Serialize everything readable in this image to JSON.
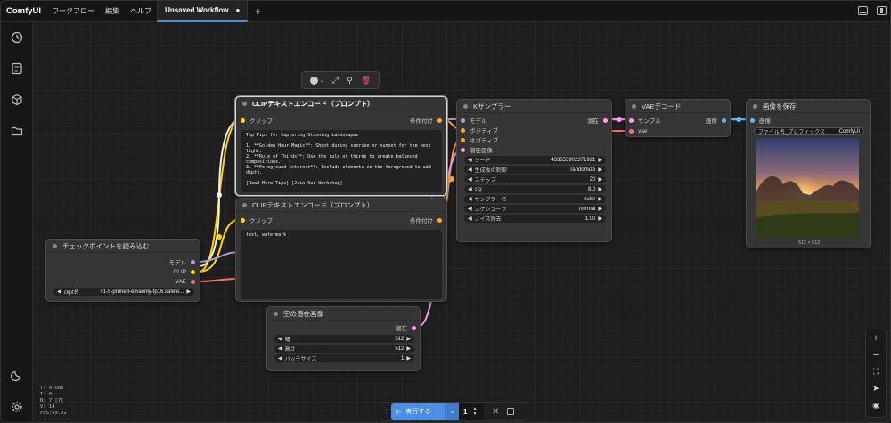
{
  "app": {
    "logo": "ComfyUI",
    "menu": [
      "ワークフロー",
      "編集",
      "ヘルプ"
    ],
    "tab_title": "Unsaved Workflow",
    "tab_modified": "●",
    "new_tab": "+"
  },
  "stats": {
    "t": "T: 0.00s",
    "i": "I: 0",
    "n": "N: 7 [7]",
    "v": "V: 14",
    "fps": "FPS:59.52"
  },
  "nodes": {
    "clip1": {
      "title": "CLIPテキストエンコード（プロンプト）",
      "in": "クリップ",
      "out": "条件付け",
      "text": "Top Tips for Capturing Stunning Landscapes\n\n1. **Golden Hour Magic**: Shoot during sunrise or sunset for the best light.\n2. **Rule of Thirds**: Use the rule of thirds to create balanced compositions.\n3. **Foreground Interest**: Include elements in the foreground to add depth.\n\n[Read More Tips] [Join Our Workshop]"
    },
    "clip2": {
      "title": "CLIPテキストエンコード（プロンプト）",
      "in": "クリップ",
      "out": "条件付け",
      "text": "text, watermark"
    },
    "ckpt": {
      "title": "チェックポイントを読み込む",
      "out_model": "モデル",
      "out_clip": "CLIP",
      "out_vae": "VAE",
      "w_label": "ckpt名",
      "w_value": "v1-5-pruned-emaonly-fp16.safete..."
    },
    "ksampler": {
      "title": "Kサンプラー",
      "in_model": "モデル",
      "in_pos": "ポジティブ",
      "in_neg": "ネガティブ",
      "in_latent": "潜在画像",
      "out": "潜在",
      "widgets": [
        {
          "label": "シード",
          "value": "433653902371921"
        },
        {
          "label": "生成後の制御",
          "value": "randomize"
        },
        {
          "label": "ステップ",
          "value": "20"
        },
        {
          "label": "cfg",
          "value": "8.0"
        },
        {
          "label": "サンプラー名",
          "value": "euler"
        },
        {
          "label": "スケジューラ",
          "value": "normal"
        },
        {
          "label": "ノイズ除去",
          "value": "1.00"
        }
      ]
    },
    "vae": {
      "title": "VAEデコード",
      "in_samples": "サンプル",
      "in_vae": "vae",
      "out": "画像"
    },
    "save": {
      "title": "画像を保存",
      "in": "画像",
      "prefix": "ファイル名_プレフィックス",
      "prefix_val": "ComfyUI",
      "size": "512 × 512"
    },
    "latent": {
      "title": "空の潜在画像",
      "out": "潜在",
      "widgets": [
        {
          "label": "幅",
          "value": "512"
        },
        {
          "label": "高さ",
          "value": "512"
        },
        {
          "label": "バッチサイズ",
          "value": "1"
        }
      ]
    }
  },
  "runbar": {
    "run_label": "実行する",
    "count": "1"
  },
  "colors": {
    "model": "#b39ddb",
    "clip": "#ffd500",
    "vae": "#ff6e6e",
    "conditioning": "#ffa931",
    "latent": "#ff9cf9",
    "image": "#64b5f6",
    "accent": "#4a8ee5"
  }
}
